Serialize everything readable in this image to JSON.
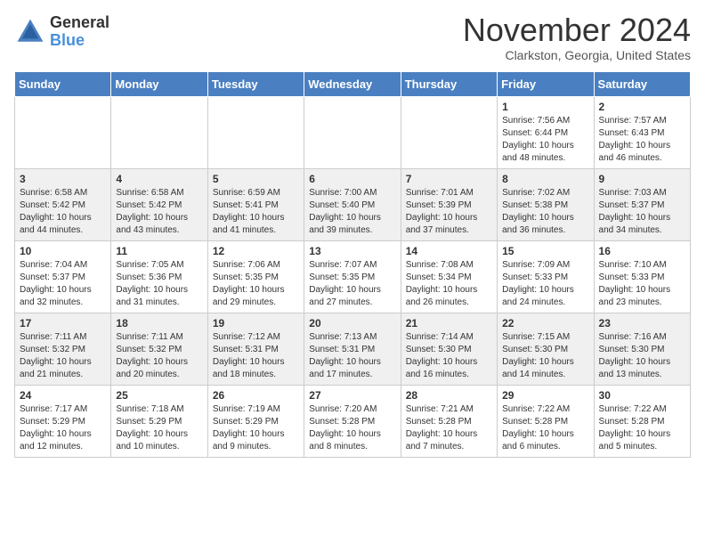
{
  "header": {
    "logo_general": "General",
    "logo_blue": "Blue",
    "month_title": "November 2024",
    "location": "Clarkston, Georgia, United States"
  },
  "weekdays": [
    "Sunday",
    "Monday",
    "Tuesday",
    "Wednesday",
    "Thursday",
    "Friday",
    "Saturday"
  ],
  "weeks": [
    [
      {
        "day": "",
        "info": ""
      },
      {
        "day": "",
        "info": ""
      },
      {
        "day": "",
        "info": ""
      },
      {
        "day": "",
        "info": ""
      },
      {
        "day": "",
        "info": ""
      },
      {
        "day": "1",
        "info": "Sunrise: 7:56 AM\nSunset: 6:44 PM\nDaylight: 10 hours\nand 48 minutes."
      },
      {
        "day": "2",
        "info": "Sunrise: 7:57 AM\nSunset: 6:43 PM\nDaylight: 10 hours\nand 46 minutes."
      }
    ],
    [
      {
        "day": "3",
        "info": "Sunrise: 6:58 AM\nSunset: 5:42 PM\nDaylight: 10 hours\nand 44 minutes."
      },
      {
        "day": "4",
        "info": "Sunrise: 6:58 AM\nSunset: 5:42 PM\nDaylight: 10 hours\nand 43 minutes."
      },
      {
        "day": "5",
        "info": "Sunrise: 6:59 AM\nSunset: 5:41 PM\nDaylight: 10 hours\nand 41 minutes."
      },
      {
        "day": "6",
        "info": "Sunrise: 7:00 AM\nSunset: 5:40 PM\nDaylight: 10 hours\nand 39 minutes."
      },
      {
        "day": "7",
        "info": "Sunrise: 7:01 AM\nSunset: 5:39 PM\nDaylight: 10 hours\nand 37 minutes."
      },
      {
        "day": "8",
        "info": "Sunrise: 7:02 AM\nSunset: 5:38 PM\nDaylight: 10 hours\nand 36 minutes."
      },
      {
        "day": "9",
        "info": "Sunrise: 7:03 AM\nSunset: 5:37 PM\nDaylight: 10 hours\nand 34 minutes."
      }
    ],
    [
      {
        "day": "10",
        "info": "Sunrise: 7:04 AM\nSunset: 5:37 PM\nDaylight: 10 hours\nand 32 minutes."
      },
      {
        "day": "11",
        "info": "Sunrise: 7:05 AM\nSunset: 5:36 PM\nDaylight: 10 hours\nand 31 minutes."
      },
      {
        "day": "12",
        "info": "Sunrise: 7:06 AM\nSunset: 5:35 PM\nDaylight: 10 hours\nand 29 minutes."
      },
      {
        "day": "13",
        "info": "Sunrise: 7:07 AM\nSunset: 5:35 PM\nDaylight: 10 hours\nand 27 minutes."
      },
      {
        "day": "14",
        "info": "Sunrise: 7:08 AM\nSunset: 5:34 PM\nDaylight: 10 hours\nand 26 minutes."
      },
      {
        "day": "15",
        "info": "Sunrise: 7:09 AM\nSunset: 5:33 PM\nDaylight: 10 hours\nand 24 minutes."
      },
      {
        "day": "16",
        "info": "Sunrise: 7:10 AM\nSunset: 5:33 PM\nDaylight: 10 hours\nand 23 minutes."
      }
    ],
    [
      {
        "day": "17",
        "info": "Sunrise: 7:11 AM\nSunset: 5:32 PM\nDaylight: 10 hours\nand 21 minutes."
      },
      {
        "day": "18",
        "info": "Sunrise: 7:11 AM\nSunset: 5:32 PM\nDaylight: 10 hours\nand 20 minutes."
      },
      {
        "day": "19",
        "info": "Sunrise: 7:12 AM\nSunset: 5:31 PM\nDaylight: 10 hours\nand 18 minutes."
      },
      {
        "day": "20",
        "info": "Sunrise: 7:13 AM\nSunset: 5:31 PM\nDaylight: 10 hours\nand 17 minutes."
      },
      {
        "day": "21",
        "info": "Sunrise: 7:14 AM\nSunset: 5:30 PM\nDaylight: 10 hours\nand 16 minutes."
      },
      {
        "day": "22",
        "info": "Sunrise: 7:15 AM\nSunset: 5:30 PM\nDaylight: 10 hours\nand 14 minutes."
      },
      {
        "day": "23",
        "info": "Sunrise: 7:16 AM\nSunset: 5:30 PM\nDaylight: 10 hours\nand 13 minutes."
      }
    ],
    [
      {
        "day": "24",
        "info": "Sunrise: 7:17 AM\nSunset: 5:29 PM\nDaylight: 10 hours\nand 12 minutes."
      },
      {
        "day": "25",
        "info": "Sunrise: 7:18 AM\nSunset: 5:29 PM\nDaylight: 10 hours\nand 10 minutes."
      },
      {
        "day": "26",
        "info": "Sunrise: 7:19 AM\nSunset: 5:29 PM\nDaylight: 10 hours\nand 9 minutes."
      },
      {
        "day": "27",
        "info": "Sunrise: 7:20 AM\nSunset: 5:28 PM\nDaylight: 10 hours\nand 8 minutes."
      },
      {
        "day": "28",
        "info": "Sunrise: 7:21 AM\nSunset: 5:28 PM\nDaylight: 10 hours\nand 7 minutes."
      },
      {
        "day": "29",
        "info": "Sunrise: 7:22 AM\nSunset: 5:28 PM\nDaylight: 10 hours\nand 6 minutes."
      },
      {
        "day": "30",
        "info": "Sunrise: 7:22 AM\nSunset: 5:28 PM\nDaylight: 10 hours\nand 5 minutes."
      }
    ]
  ]
}
